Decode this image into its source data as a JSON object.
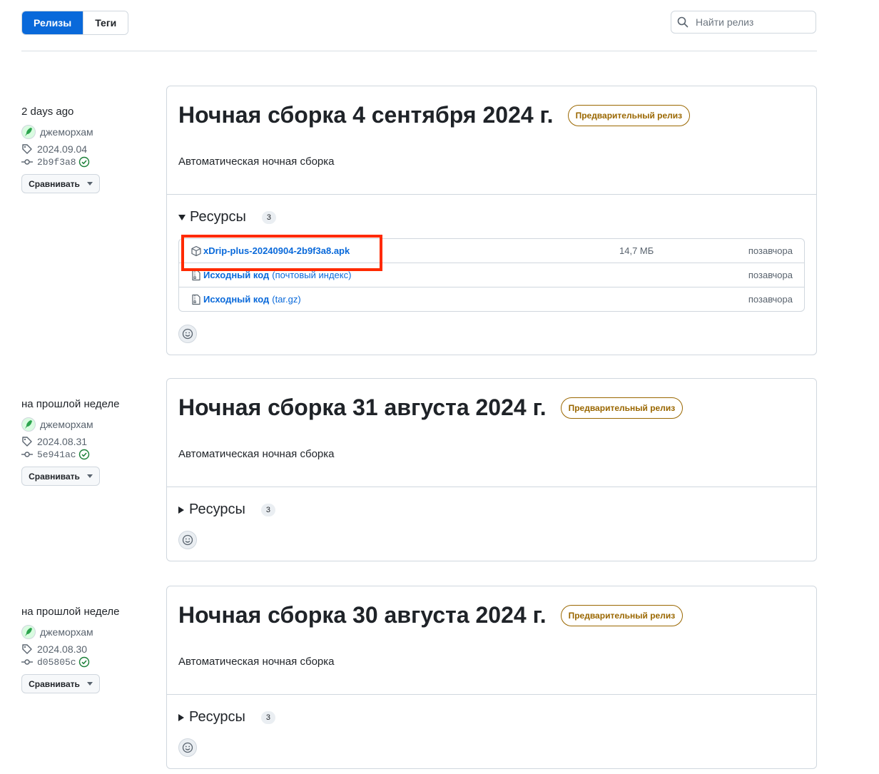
{
  "tabs": [
    {
      "label": "Релизы",
      "active": true
    },
    {
      "label": "Теги",
      "active": false
    }
  ],
  "search": {
    "placeholder": "Найти релиз",
    "value": ""
  },
  "colors": {
    "accent": "#0969da",
    "prerelease": "#9a6700",
    "highlight": "#ff2a00",
    "check": "#1a7f37"
  },
  "releases": [
    {
      "date": "2 days ago",
      "author": "джеморхам",
      "tag": "2024.09.04",
      "commit": "2b9f3a8",
      "compare_label": "Сравнивать",
      "title": "Ночная сборка 4 сентября 2024 г.",
      "badge": "Предварительный релиз",
      "description": "Автоматическая ночная сборка",
      "assets_label": "Ресурсы",
      "assets_count": "3",
      "expanded": true,
      "assets": [
        {
          "icon": "package-icon",
          "name": "xDrip-plus-20240904-2b9f3a8.apk",
          "sub": "",
          "size": "14,7 МБ",
          "when": "позавчора"
        },
        {
          "icon": "file-zip-icon",
          "name": "Исходный код",
          "sub": "(почтовый индекс)",
          "size": "",
          "when": "позавчора"
        },
        {
          "icon": "file-zip-icon",
          "name": "Исходный код",
          "sub": "(tar.gz)",
          "size": "",
          "when": "позавчора"
        }
      ]
    },
    {
      "date": "на прошлой неделе",
      "author": "джеморхам",
      "tag": "2024.08.31",
      "commit": "5e941ac",
      "compare_label": "Сравнивать",
      "title": "Ночная сборка 31 августа 2024 г.",
      "badge": "Предварительный релиз",
      "description": "Автоматическая ночная сборка",
      "assets_label": "Ресурсы",
      "assets_count": "3",
      "expanded": false
    },
    {
      "date": "на прошлой неделе",
      "author": "джеморхам",
      "tag": "2024.08.30",
      "commit": "d05805c",
      "compare_label": "Сравнивать",
      "title": "Ночная сборка 30 августа 2024 г.",
      "badge": "Предварительный релиз",
      "description": "Автоматическая ночная сборка",
      "assets_label": "Ресурсы",
      "assets_count": "3",
      "expanded": false
    }
  ]
}
